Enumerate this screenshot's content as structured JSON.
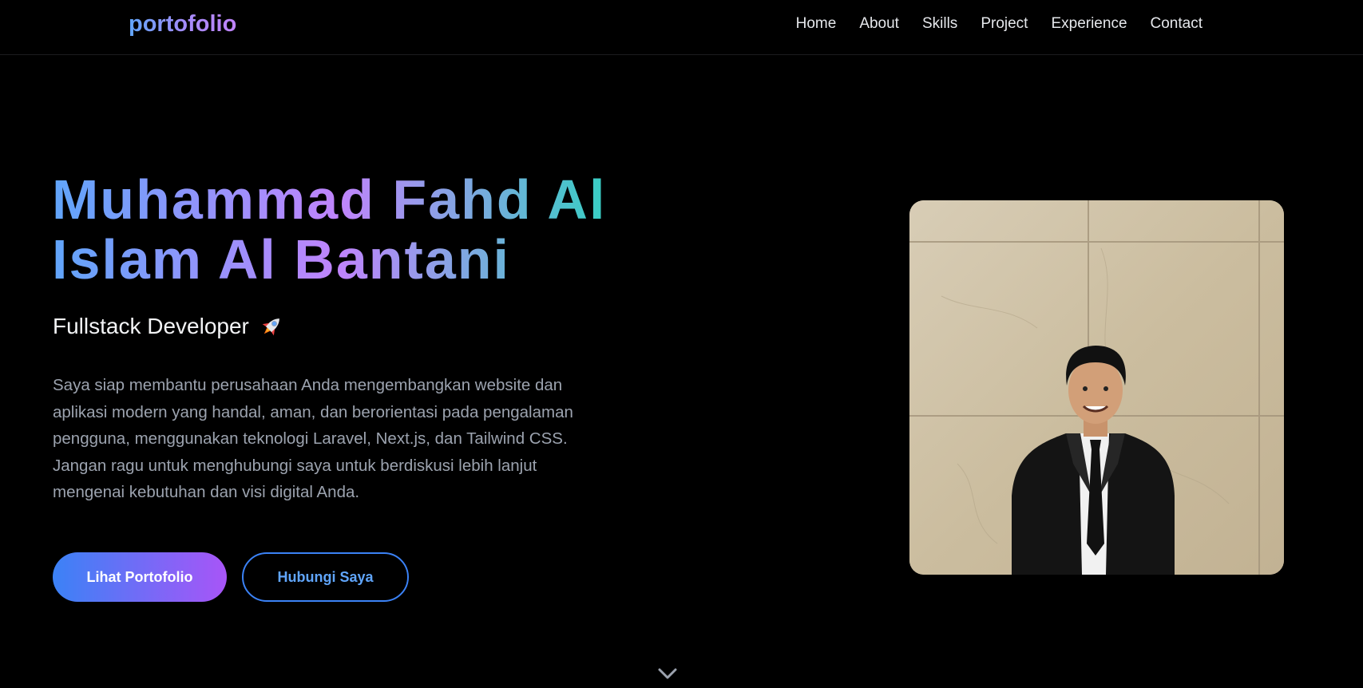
{
  "nav": {
    "logo": "portofolio",
    "links": [
      "Home",
      "About",
      "Skills",
      "Project",
      "Experience",
      "Contact"
    ]
  },
  "hero": {
    "title_line1": "Muhammad Fahd Al",
    "title_line2": "Islam Al Bantani",
    "subtitle": "Fullstack Developer",
    "subtitle_icon": "rocket-icon",
    "description": "Saya siap membantu perusahaan Anda mengembangkan website dan aplikasi modern yang handal, aman, dan berorientasi pada pengalaman pengguna, menggunakan teknologi Laravel, Next.js, dan Tailwind CSS. Jangan ragu untuk menghubungi saya untuk berdiskusi lebih lanjut mengenai kebutuhan dan visi digital Anda.",
    "primary_button": "Lihat Portofolio",
    "secondary_button": "Hubungi Saya"
  },
  "photo": {
    "icon": "profile-photo"
  },
  "scroll": {
    "icon": "chevron-down-icon"
  },
  "colors": {
    "background": "#000000",
    "accent_blue": "#3b82f6",
    "accent_purple": "#a855f7",
    "accent_teal": "#2dd4bf",
    "text_muted": "#9ca3af"
  }
}
